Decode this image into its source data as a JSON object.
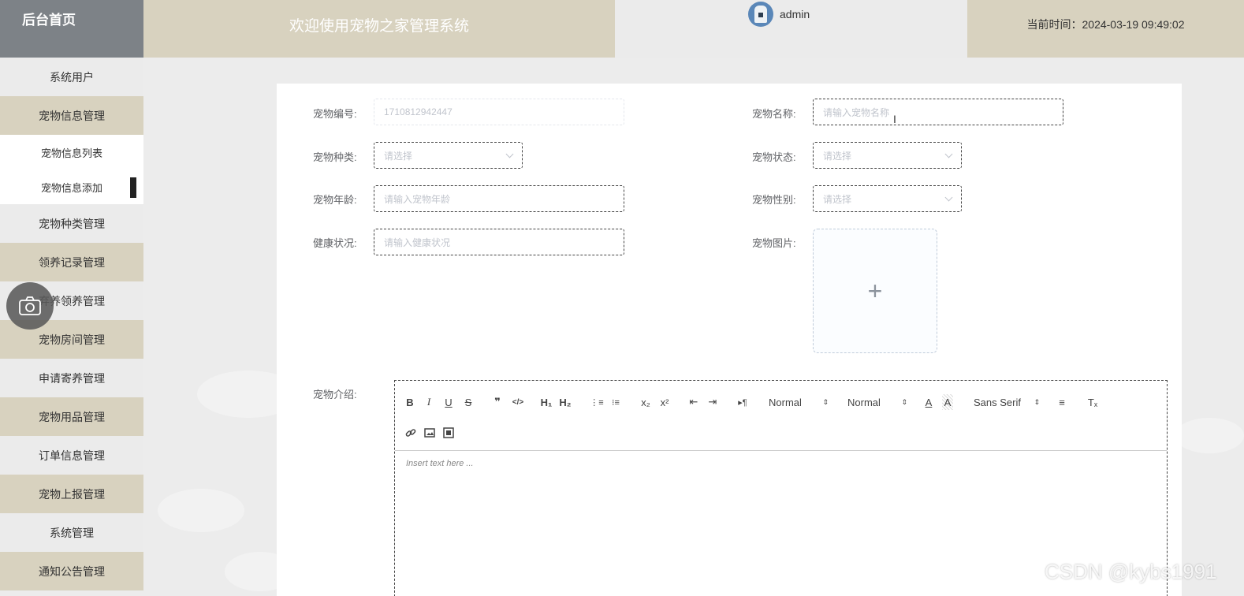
{
  "header": {
    "brand": "后台首页",
    "welcome": "欢迎使用宠物之家管理系统",
    "user": "admin",
    "time_text": "当前时间：2024-03-19 09:49:02"
  },
  "sidebar": {
    "items": [
      {
        "label": "系统用户"
      },
      {
        "label": "宠物信息管理"
      },
      {
        "label": "宠物信息列表"
      },
      {
        "label": "宠物信息添加"
      },
      {
        "label": "宠物种类管理"
      },
      {
        "label": "领养记录管理"
      },
      {
        "label": "弃养领养管理"
      },
      {
        "label": "宠物房间管理"
      },
      {
        "label": "申请寄养管理"
      },
      {
        "label": "宠物用品管理"
      },
      {
        "label": "订单信息管理"
      },
      {
        "label": "宠物上报管理"
      },
      {
        "label": "系统管理"
      },
      {
        "label": "通知公告管理"
      }
    ]
  },
  "form": {
    "pet_no": {
      "label": "宠物编号:",
      "value": "1710812942447"
    },
    "pet_name": {
      "label": "宠物名称:",
      "placeholder": "请输入宠物名称"
    },
    "pet_type": {
      "label": "宠物种类:",
      "placeholder": "请选择"
    },
    "pet_status": {
      "label": "宠物状态:",
      "placeholder": "请选择"
    },
    "pet_age": {
      "label": "宠物年龄:",
      "placeholder": "请输入宠物年龄"
    },
    "pet_gender": {
      "label": "宠物性别:",
      "placeholder": "请选择"
    },
    "health": {
      "label": "健康状况:",
      "placeholder": "请输入健康状况"
    },
    "pet_image": {
      "label": "宠物图片:",
      "plus": "+"
    },
    "intro": {
      "label": "宠物介绍:"
    }
  },
  "editor": {
    "buttons": {
      "bold": "B",
      "italic": "I",
      "underline": "U",
      "strike": "S",
      "blockquote": "❞",
      "code": "</>",
      "h1": "H₁",
      "h2": "H₂",
      "ordered": "⋮≡",
      "bullet": "⁝≡",
      "sub": "x₂",
      "sup": "x²",
      "outdent": "⇤",
      "indent": "⇥",
      "direction": "▸¶",
      "color": "A",
      "background": "A",
      "align": "≡",
      "clean": "Tₓ"
    },
    "size_select": "Normal",
    "header_select": "Normal",
    "font_select": "Sans Serif",
    "arrows": "⇕",
    "placeholder": "Insert text here ..."
  },
  "watermark": "CSDN @kybs1991"
}
